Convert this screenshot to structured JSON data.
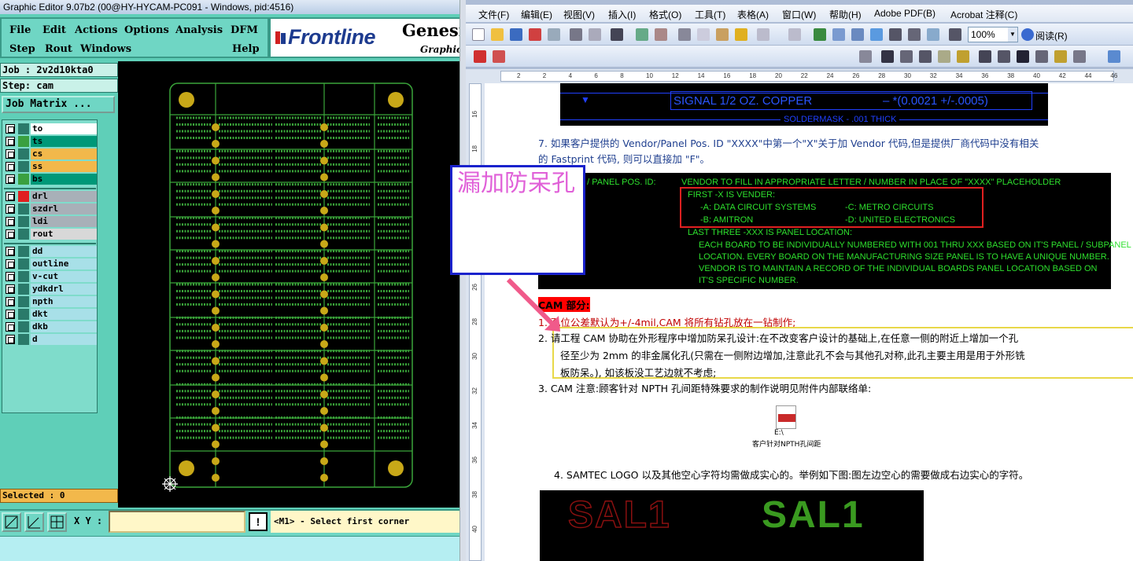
{
  "genesis": {
    "title": "Graphic Editor 9.07b2 (00@HY-HYCAM-PC091 - Windows, pid:4516)",
    "menu_row1": [
      "File",
      "Edit",
      "Actions",
      "Options",
      "Analysis",
      "DFM"
    ],
    "menu_row2": [
      "Step",
      "Rout",
      "Windows",
      "Help"
    ],
    "logo": {
      "brand": "Frontline",
      "product": "Genesis",
      "sub": "Graphic"
    },
    "job_field": "Job : 2v2d10kta0",
    "step_field": "Step: cam",
    "job_matrix_label": "Job Matrix ...",
    "layers": [
      {
        "name": "to",
        "color": "#ffffff"
      },
      {
        "name": "ts",
        "color": "#009878"
      },
      {
        "name": "cs",
        "color": "#f2b84b"
      },
      {
        "name": "ss",
        "color": "#f2b84b"
      },
      {
        "name": "bs",
        "color": "#009878"
      },
      {
        "name": "drl",
        "color": "#a8b0b8"
      },
      {
        "name": "szdrl",
        "color": "#a8b0b8"
      },
      {
        "name": "ldi",
        "color": "#a8b0b8"
      },
      {
        "name": "rout",
        "color": "#d8d8d8"
      },
      {
        "name": "dd",
        "color": "#a8e0e8"
      },
      {
        "name": "outline",
        "color": "#a8e0e8"
      },
      {
        "name": "v-cut",
        "color": "#a8e0e8"
      },
      {
        "name": "ydkdrl",
        "color": "#a8e0e8"
      },
      {
        "name": "npth",
        "color": "#a8e0e8"
      },
      {
        "name": "dkt",
        "color": "#a8e0e8"
      },
      {
        "name": "dkb",
        "color": "#a8e0e8"
      },
      {
        "name": "d",
        "color": "#a8e0e8"
      }
    ],
    "selected": "Selected : 0",
    "xy_label": "X Y :",
    "xy_value": "",
    "bang": "!",
    "status": "<M1> - Select first corner"
  },
  "word": {
    "menus": [
      "文件(F)",
      "编辑(E)",
      "视图(V)",
      "插入(I)",
      "格式(O)",
      "工具(T)",
      "表格(A)",
      "窗口(W)",
      "帮助(H)",
      "Adobe PDF(B)",
      "Acrobat 注释(C)"
    ],
    "zoom": "100%",
    "read_label": "阅读(R)",
    "ruler_h": [
      "2",
      "2",
      "4",
      "6",
      "8",
      "10",
      "12",
      "14",
      "16",
      "18",
      "20",
      "22",
      "24",
      "26",
      "28",
      "30",
      "32",
      "34",
      "36",
      "38",
      "40",
      "42",
      "44",
      "46",
      "52"
    ],
    "ruler_v": [
      "16",
      "18",
      "20",
      "22",
      "24",
      "26",
      "28",
      "30",
      "32",
      "34",
      "36",
      "38",
      "40"
    ],
    "stackup": {
      "line1": "SIGNAL 1/2 OZ. COPPER",
      "line1b": "–  *(0.0021 +/-.0005)",
      "line2": "SOLDERMASK - .001 THICK"
    },
    "item7": "7. 如果客户提供的 Vendor/Panel Pos. ID \"XXXX\"中第一个\"X\"关于加 Vendor 代码,但是提供厂商代码中没有相关",
    "item7b": "的 Fastprint 代码, 则可以直接加 \"F\"。",
    "vendor_img": {
      "label": "VENDOR / PANEL POS. ID:",
      "l1": "VENDOR TO FILL IN APPROPRIATE LETTER / NUMBER IN PLACE OF \"XXXX\" PLACEHOLDER",
      "l2": "FIRST -X IS VENDER:",
      "l3a": "-A:  DATA CIRCUIT SYSTEMS",
      "l3b": "-C:  METRO CIRCUITS",
      "l4a": "-B:  AMITRON",
      "l4b": "-D:  UNITED ELECTRONICS",
      "l5": "LAST THREE -XXX IS PANEL LOCATION:",
      "l6": "EACH BOARD TO BE  INDIVIDUALLY NUMBERED WITH 001 THRU XXX BASED ON IT'S PANEL / SUBPANEL",
      "l7": "LOCATION.  EVERY BOARD ON THE MANUFACTURING SIZE PANEL IS TO HAVE A UNIQUE NUMBER.",
      "l8": "VENDOR IS TO MAINTAIN A RECORD OF THE INDIVIDUAL BOARDS PANEL LOCATION BASED ON",
      "l9": "IT'S SPECIFIC NUMBER."
    },
    "callout_text": "漏加防呆孔",
    "cam_heading": "CAM 部分:",
    "cam1": "1.  孔位公差默认为+/-4mil,CAM 将所有钻孔放在一钻制作;",
    "cam2a": "2.  请工程 CAM 协助在外形程序中增加防呆孔设计:在不改变客户设计的基础上,在任意一侧的附近上增加一个孔",
    "cam2b": "径至少为 2mm 的非金属化孔(只需在一侧附边增加,注意此孔不会与其他孔对称,此孔主要主用是用于外形铣",
    "cam2c": "板防呆。), 如该板没工艺边就不考虑;",
    "cam3": "3.  CAM 注意:顾客针对 NPTH 孔间距特殊要求的制作说明见附件内部联络单:",
    "attach_path": "E:\\",
    "attach_name": "客户针对NPTH孔间距",
    "item4": "4. SAMTEC LOGO 以及其他空心字符均需做成实心的。举例如下图:图左边空心的需要做成右边实心的字符。",
    "logo_outline": "SAL1",
    "logo_solid": "SAL1"
  },
  "colors": {
    "pcb_green": "#3aa53a",
    "pad_yellow": "#c8a818",
    "red_heading": "#ff0000",
    "callout_border": "#1a22cc",
    "callout_text": "#e060d8",
    "highlight_box": "#e8d848"
  }
}
